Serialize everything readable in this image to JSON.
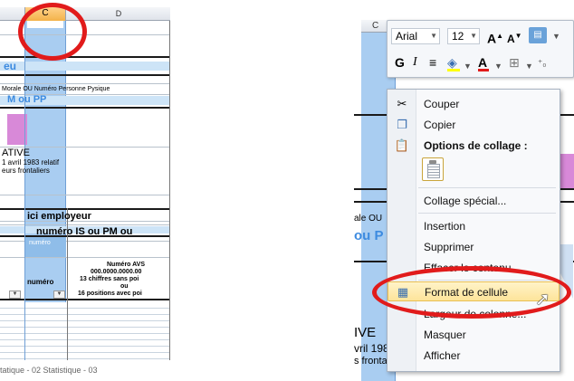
{
  "left": {
    "col_header_c": "C",
    "col_header_d": "D",
    "label_eu": "eu",
    "label_morale_ou": "Morale OU Numéro Personne Pysique",
    "label_m_ou_pp": "M ou PP",
    "label_ative": "ATIVE",
    "label_avril": "1 avril 1983 relatif",
    "label_frontaliers": "eurs frontaliers",
    "label_ici_employeur": "ici employeur",
    "label_numero_is": "numéro IS ou PM ou",
    "label_numero_small": "numéro",
    "label_numero": "numéro",
    "label_numero_avs": "Numéro AVS",
    "label_avs_format": "000.0000.0000.00",
    "label_13_chiffres": "13 chiffres sans poi",
    "label_ou": "ou",
    "label_16_positions": "16 positions avec poi",
    "label_bottom_tabs": "tatique - 02      Statistique - 03"
  },
  "right": {
    "col_header": "C",
    "toolbar": {
      "font_name": "Arial",
      "font_size": "12",
      "grow_font": "A",
      "shrink_font": "A",
      "bold": "G",
      "italic": "I",
      "align": "≡",
      "font_color": "A"
    },
    "background_labels": {
      "morale_ou": "ale OU",
      "ou_p": "ou P",
      "ive": "IVE",
      "vril": "vril 198",
      "frontaliers": "s frontaliers"
    },
    "menu": {
      "couper": "Couper",
      "copier": "Copier",
      "options_collage": "Options de collage :",
      "collage_special": "Collage spécial...",
      "insertion": "Insertion",
      "supprimer": "Supprimer",
      "effacer": "Effacer le contenu",
      "format_cellule": "Format de cellule",
      "largeur_colonne": "Largeur de colonne...",
      "masquer": "Masquer",
      "afficher": "Afficher"
    },
    "highlight_color": "#fde49a",
    "annotation_color": "#e11b1b"
  }
}
